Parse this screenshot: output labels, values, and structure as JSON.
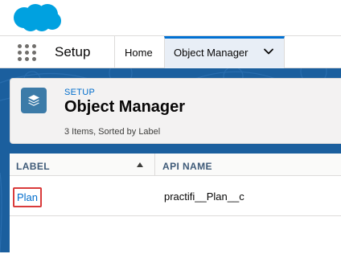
{
  "brand": {
    "logo_icon": "salesforce-cloud-icon",
    "logo_color": "#00a1e0"
  },
  "nav": {
    "app_launcher_icon": "app-launcher-waffle-icon",
    "app_name": "Setup",
    "tabs": [
      {
        "label": "Home",
        "active": false
      },
      {
        "label": "Object Manager",
        "active": true,
        "menu_icon": "chevron-down-icon"
      }
    ]
  },
  "header": {
    "icon": "stacked-layers-icon",
    "eyebrow": "SETUP",
    "title": "Object Manager",
    "meta": "3 Items, Sorted by Label"
  },
  "table": {
    "columns": [
      {
        "label": "LABEL",
        "sorted": "ascending"
      },
      {
        "label": "API NAME"
      }
    ],
    "rows": [
      {
        "label": "Plan",
        "api_name": "practifi__Plan__c",
        "highlighted": true
      }
    ]
  },
  "colors": {
    "accent": "#0070d2",
    "link": "#006dcc",
    "background_blue": "#1b5f9e",
    "highlight_box": "#d93b3b"
  }
}
